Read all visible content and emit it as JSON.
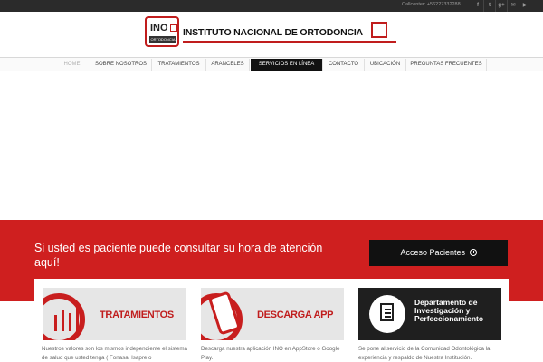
{
  "topbar": {
    "callcenter": "Callcenter: +56227332288",
    "social": [
      {
        "icon": "facebook-icon",
        "glyph": "f"
      },
      {
        "icon": "twitter-icon",
        "glyph": "t"
      },
      {
        "icon": "google-plus-icon",
        "glyph": "g+"
      },
      {
        "icon": "email-icon",
        "glyph": "✉"
      },
      {
        "icon": "youtube-icon",
        "glyph": "▶"
      }
    ]
  },
  "logo": {
    "ino": "INO",
    "sub": "ORTODONCIA",
    "title": "INSTITUTO NACIONAL DE ORTODONCIA"
  },
  "nav": {
    "items": [
      {
        "label": "Home"
      },
      {
        "label": "Sobre Nosotros"
      },
      {
        "label": "Tratamientos"
      },
      {
        "label": "Aranceles"
      },
      {
        "label": "Servicios en Línea"
      },
      {
        "label": "Contacto"
      },
      {
        "label": "Ubicación"
      },
      {
        "label": "Preguntas Frecuentes"
      }
    ],
    "active_index": 4
  },
  "banner": {
    "text": "Si usted es paciente puede consultar su hora de atención aquí!",
    "button_label": "Acceso Pacientes",
    "button_icon": "clock-icon",
    "color": "#cf1f1f"
  },
  "cards": [
    {
      "image_label": "TRATAMIENTOS",
      "text": "Nuestros valores son los mismos independiente el sistema de salud que usted tenga ( Fonasa, Isapre o"
    },
    {
      "image_label": "DESCARGA APP",
      "text": "Descarga nuestra aplicación INO en AppStore o Google Play."
    },
    {
      "image_label": "Departamento de Investigación y Perfeccionamiento",
      "text": "Se pone al servicio de la Comunidad Odontológica la experiencia y respaldo de Nuestra Institución."
    }
  ],
  "colors": {
    "accent": "#cf1f1f",
    "dark": "#111111",
    "topbar": "#2b2b2b"
  }
}
